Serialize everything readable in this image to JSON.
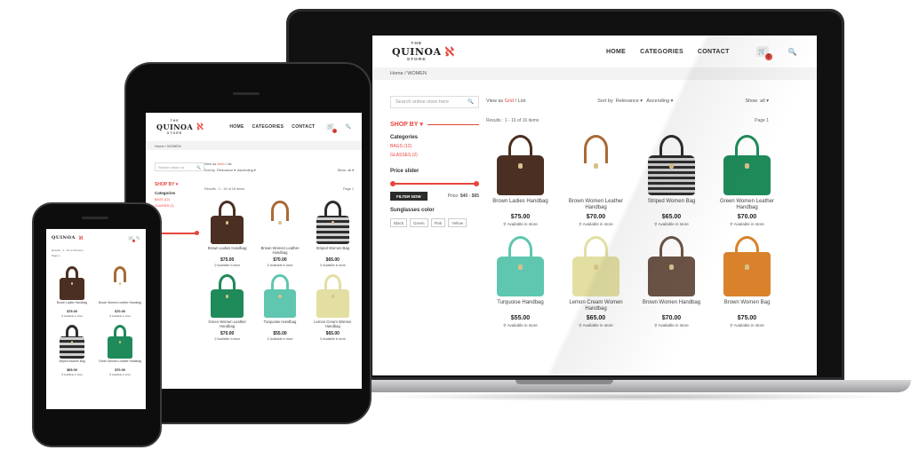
{
  "site": {
    "logo_top": "THE",
    "logo_name": "QUINOA",
    "logo_bottom": "STORE",
    "nav": [
      "HOME",
      "CATEGORIES",
      "CONTACT"
    ],
    "cart_count": "0",
    "breadcrumb": "Home  /  WOMEN",
    "search_placeholder": "Search online store here",
    "search_placeholder_short": "Search online st",
    "view_prefix": "View as",
    "view_grid": "Grid",
    "view_sep": "/",
    "view_list": "List",
    "sort_label": "Sort by",
    "sort_value": "Relevance",
    "order_value": "Ascending",
    "show_label": "Show",
    "show_value": "all",
    "results_text": "Results : 1 - 16 of 16 items",
    "page_label": "Page",
    "page_value": "1",
    "shop_by": "SHOP BY",
    "categories_heading": "Categories",
    "categories": [
      "BAGS (12)",
      "GLASSES (2)"
    ],
    "price_slider_label": "Price slider",
    "filter_button": "FILTER NOW",
    "price_label": "Price:",
    "price_range": "$40 - $85",
    "colors_heading": "Sunglasses color",
    "colors": [
      "Black",
      "Green",
      "Pink",
      "Yellow"
    ]
  },
  "products": [
    {
      "name": "Brown Ladies Handbag",
      "price": "$75.00",
      "availability": "Available in store",
      "color": "#4a2f22",
      "style": "solid"
    },
    {
      "name": "Brown Women Leather Handbag",
      "price": "$70.00",
      "availability": "Available in store",
      "color": "#a86a34",
      "style": "brown-striped"
    },
    {
      "name": "Striped Women Bag",
      "price": "$65.00",
      "availability": "Available in store",
      "color": "#2d2d2d",
      "style": "stripe"
    },
    {
      "name": "Green Women Leather Handbag",
      "price": "$70.00",
      "availability": "Available in store",
      "color": "#1f8a5a",
      "style": "solid"
    },
    {
      "name": "Turquoise Handbag",
      "price": "$55.00",
      "availability": "Available in store",
      "color": "#5fc7b0",
      "style": "solid"
    },
    {
      "name": "Lemon Cream Women Handbag",
      "price": "$65.00",
      "availability": "Available in store",
      "color": "#e3dfa3",
      "style": "solid"
    },
    {
      "name": "Brown Women Handbag",
      "price": "$70.00",
      "availability": "Available in store",
      "color": "#6b5446",
      "style": "solid"
    },
    {
      "name": "Brown Women Bag",
      "price": "$75.00",
      "availability": "Available in store",
      "color": "#d9822b",
      "style": "crossbody"
    }
  ],
  "tablet_products": [
    0,
    1,
    2,
    3,
    4,
    5
  ],
  "phone_products": [
    0,
    1,
    2,
    3
  ],
  "colors": {
    "accent": "#e8453c",
    "dark_button": "#2b2b2b",
    "breadcrumb_bg": "#f3f3f3"
  }
}
